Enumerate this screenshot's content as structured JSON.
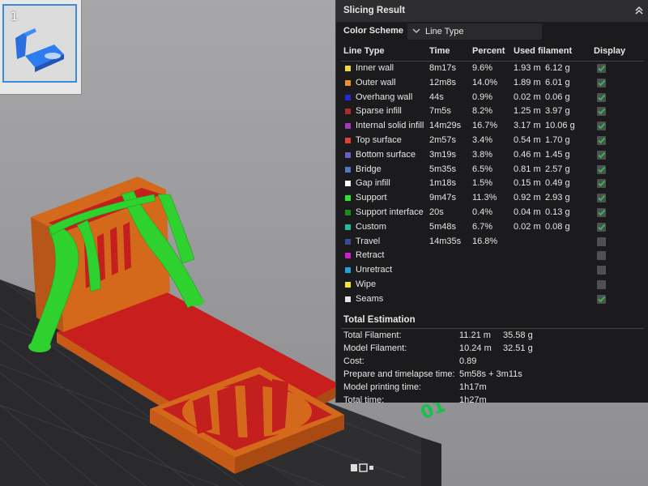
{
  "plate": {
    "number": "1"
  },
  "panel": {
    "title": "Slicing Result",
    "color_scheme_label": "Color Scheme",
    "color_scheme_value": "Line Type",
    "columns": {
      "line_type": "Line Type",
      "time": "Time",
      "percent": "Percent",
      "used_filament": "Used filament",
      "display": "Display"
    },
    "rows": [
      {
        "name": "Inner wall",
        "time": "8m17s",
        "percent": "9.6%",
        "length": "1.93 m",
        "weight": "6.12 g",
        "color": "#f4d73b",
        "checked": true
      },
      {
        "name": "Outer wall",
        "time": "12m8s",
        "percent": "14.0%",
        "length": "1.89 m",
        "weight": "6.01 g",
        "color": "#f28f27",
        "checked": true
      },
      {
        "name": "Overhang wall",
        "time": "44s",
        "percent": "0.9%",
        "length": "0.02 m",
        "weight": "0.06 g",
        "color": "#1f2ad9",
        "checked": true
      },
      {
        "name": "Sparse infill",
        "time": "7m5s",
        "percent": "8.2%",
        "length": "1.25 m",
        "weight": "3.97 g",
        "color": "#b02a2a",
        "checked": true
      },
      {
        "name": "Internal solid infill",
        "time": "14m29s",
        "percent": "16.7%",
        "length": "3.17 m",
        "weight": "10.06 g",
        "color": "#a33ab8",
        "checked": true
      },
      {
        "name": "Top surface",
        "time": "2m57s",
        "percent": "3.4%",
        "length": "0.54 m",
        "weight": "1.70 g",
        "color": "#e83b3b",
        "checked": true
      },
      {
        "name": "Bottom surface",
        "time": "3m19s",
        "percent": "3.8%",
        "length": "0.46 m",
        "weight": "1.45 g",
        "color": "#6a5fc4",
        "checked": true
      },
      {
        "name": "Bridge",
        "time": "5m35s",
        "percent": "6.5%",
        "length": "0.81 m",
        "weight": "2.57 g",
        "color": "#4a7bc2",
        "checked": true
      },
      {
        "name": "Gap infill",
        "time": "1m18s",
        "percent": "1.5%",
        "length": "0.15 m",
        "weight": "0.49 g",
        "color": "#ffffff",
        "checked": true
      },
      {
        "name": "Support",
        "time": "9m47s",
        "percent": "11.3%",
        "length": "0.92 m",
        "weight": "2.93 g",
        "color": "#2ee52e",
        "checked": true
      },
      {
        "name": "Support interface",
        "time": "20s",
        "percent": "0.4%",
        "length": "0.04 m",
        "weight": "0.13 g",
        "color": "#188f18",
        "checked": true
      },
      {
        "name": "Custom",
        "time": "5m48s",
        "percent": "6.7%",
        "length": "0.02 m",
        "weight": "0.08 g",
        "color": "#1fbf9a",
        "checked": true
      },
      {
        "name": "Travel",
        "time": "14m35s",
        "percent": "16.8%",
        "length": "",
        "weight": "",
        "color": "#3a4a9c",
        "checked": false
      },
      {
        "name": "Retract",
        "time": "",
        "percent": "",
        "length": "",
        "weight": "",
        "color": "#d11bd1",
        "checked": false
      },
      {
        "name": "Unretract",
        "time": "",
        "percent": "",
        "length": "",
        "weight": "",
        "color": "#1ba6d9",
        "checked": false
      },
      {
        "name": "Wipe",
        "time": "",
        "percent": "",
        "length": "",
        "weight": "",
        "color": "#f2e52a",
        "checked": false
      },
      {
        "name": "Seams",
        "time": "",
        "percent": "",
        "length": "",
        "weight": "",
        "color": "#e6e6e6",
        "checked": true
      }
    ],
    "total": {
      "title": "Total Estimation",
      "rows": [
        {
          "label": "Total Filament:",
          "v1": "11.21 m",
          "v2": "35.58 g"
        },
        {
          "label": "Model Filament:",
          "v1": "10.24 m",
          "v2": "32.51 g"
        },
        {
          "label": "Cost:",
          "v1": "0.89",
          "v2": ""
        },
        {
          "label": "Prepare and timelapse time:",
          "v1": "5m58s + 3m11s",
          "v2": ""
        },
        {
          "label": "Model printing time:",
          "v1": "1h17m",
          "v2": ""
        },
        {
          "label": "Total time:",
          "v1": "1h27m",
          "v2": ""
        }
      ]
    }
  },
  "bed": {
    "plate_label": "01"
  },
  "colors": {
    "model_orange": "#d4691c",
    "model_red": "#c41f1f",
    "support_green": "#2fd12f",
    "panel_bg": "#1b1b1d",
    "check_green": "#2fbf4a",
    "selection_blue": "#3a8bd8"
  }
}
